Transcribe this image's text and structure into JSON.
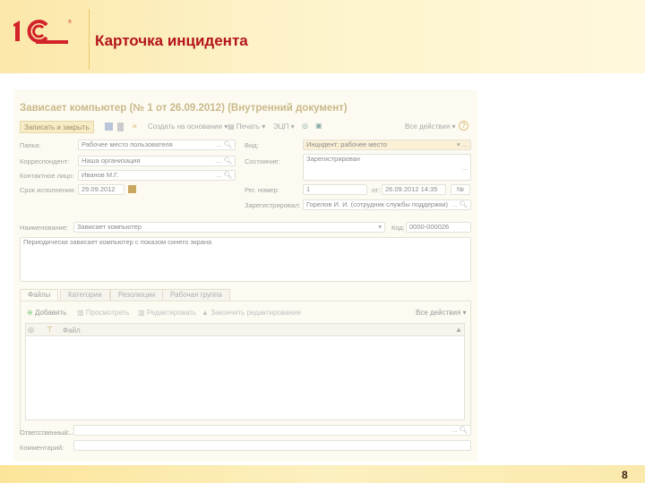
{
  "slide": {
    "title": "Карточка инцидента",
    "page_number": "8",
    "logo_text": "1С"
  },
  "form": {
    "title": "Зависает компьютер (№ 1 от 26.09.2012) (Внутренний документ)",
    "toolbar": {
      "save_close": "Записать и закрыть",
      "create_based": "Создать на основании ▾",
      "print": "Печать ▾",
      "esign": "ЭЦП ▾",
      "all_actions": "Все действия ▾",
      "help": "?"
    },
    "fields": {
      "folder": {
        "label": "Папка:",
        "value": "Рабочее место пользователя"
      },
      "correspondent": {
        "label": "Корреспондент:",
        "value": "Наша организация"
      },
      "contact": {
        "label": "Контактное лицо:",
        "value": "Иванов М.Г."
      },
      "deadline": {
        "label": "Срок исполнения:",
        "value": "29.09.2012"
      },
      "kind": {
        "label": "Вид:",
        "value": "Инцидент: рабочее место"
      },
      "state": {
        "label": "Состояние:",
        "value": "Зарегистрирован"
      },
      "reg_number": {
        "label": "Рег. номер:",
        "value": "1",
        "from_label": "от:",
        "date": "26.09.2012 14:35",
        "no_button": "№"
      },
      "registered_by": {
        "label": "Зарегистрировал:",
        "value": "Горелов И. И. (сотрудник службы поддержки)"
      },
      "name": {
        "label": "Наименование:",
        "value": "Зависает компьютер",
        "code_label": "Код:",
        "code": "0000-000026"
      },
      "description": "Периодически зависает компьютер с показом синего экрана",
      "responsible": {
        "label": "Ответственный:",
        "value": ""
      },
      "comment": {
        "label": "Комментарий:",
        "value": ""
      }
    },
    "tabs": [
      "Файлы",
      "Категории",
      "Резолюции",
      "Рабочая группа"
    ],
    "files_toolbar": {
      "add": "Добавить",
      "view": "Просмотреть",
      "edit": "Редактировать",
      "finish": "Закончить редактирование",
      "all_actions": "Все действия ▾"
    },
    "files_table": {
      "column": "Файл",
      "rows": []
    }
  }
}
